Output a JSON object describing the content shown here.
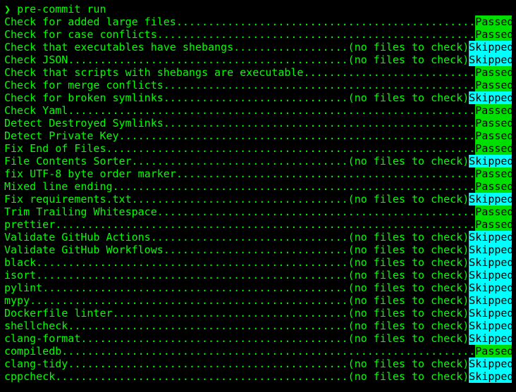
{
  "prompt": {
    "symbol": "❯",
    "command": "pre-commit run"
  },
  "total_width": 80,
  "statuses": {
    "passed": {
      "label": "Passed",
      "class": "status-passed"
    },
    "skipped": {
      "label": "Skipped",
      "class": "status-skipped"
    }
  },
  "hooks": [
    {
      "name": "Check for added large files",
      "note": "",
      "status": "passed"
    },
    {
      "name": "Check for case conflicts",
      "note": "",
      "status": "passed"
    },
    {
      "name": "Check that executables have shebangs",
      "note": "(no files to check)",
      "status": "skipped"
    },
    {
      "name": "Check JSON",
      "note": "(no files to check)",
      "status": "skipped"
    },
    {
      "name": "Check that scripts with shebangs are executable",
      "note": "",
      "status": "passed"
    },
    {
      "name": "Check for merge conflicts",
      "note": "",
      "status": "passed"
    },
    {
      "name": "Check for broken symlinks",
      "note": "(no files to check)",
      "status": "skipped"
    },
    {
      "name": "Check Yaml",
      "note": "",
      "status": "passed"
    },
    {
      "name": "Detect Destroyed Symlinks",
      "note": "",
      "status": "passed"
    },
    {
      "name": "Detect Private Key",
      "note": "",
      "status": "passed"
    },
    {
      "name": "Fix End of Files",
      "note": "",
      "status": "passed"
    },
    {
      "name": "File Contents Sorter",
      "note": "(no files to check)",
      "status": "skipped"
    },
    {
      "name": "fix UTF-8 byte order marker",
      "note": "",
      "status": "passed"
    },
    {
      "name": "Mixed line ending",
      "note": "",
      "status": "passed"
    },
    {
      "name": "Fix requirements.txt",
      "note": "(no files to check)",
      "status": "skipped"
    },
    {
      "name": "Trim Trailing Whitespace",
      "note": "",
      "status": "passed"
    },
    {
      "name": "prettier",
      "note": "",
      "status": "passed"
    },
    {
      "name": "Validate GitHub Actions",
      "note": "(no files to check)",
      "status": "skipped"
    },
    {
      "name": "Validate GitHub Workflows",
      "note": "(no files to check)",
      "status": "skipped"
    },
    {
      "name": "black",
      "note": "(no files to check)",
      "status": "skipped"
    },
    {
      "name": "isort",
      "note": "(no files to check)",
      "status": "skipped"
    },
    {
      "name": "pylint",
      "note": "(no files to check)",
      "status": "skipped"
    },
    {
      "name": "mypy",
      "note": "(no files to check)",
      "status": "skipped"
    },
    {
      "name": "Dockerfile linter",
      "note": "(no files to check)",
      "status": "skipped"
    },
    {
      "name": "shellcheck",
      "note": "(no files to check)",
      "status": "skipped"
    },
    {
      "name": "clang-format",
      "note": "(no files to check)",
      "status": "skipped"
    },
    {
      "name": "compiledb",
      "note": "",
      "status": "passed"
    },
    {
      "name": "clang-tidy",
      "note": "(no files to check)",
      "status": "skipped"
    },
    {
      "name": "cppcheck",
      "note": "(no files to check)",
      "status": "skipped"
    }
  ]
}
